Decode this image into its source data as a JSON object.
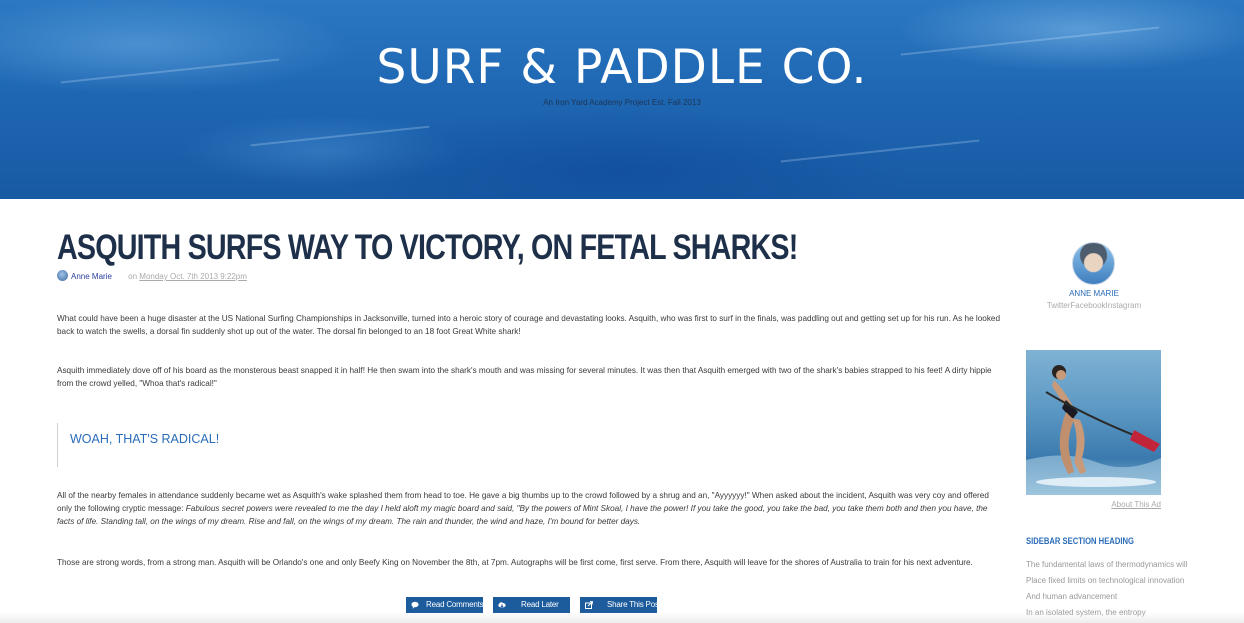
{
  "header": {
    "site_title": "SURF & PADDLE CO.",
    "tagline": "An Iron Yard Academy Project Est. Fall 2013"
  },
  "post": {
    "title": "ASQUITH SURFS WAY TO VICTORY, ON FETAL SHARKS!",
    "author": "Anne Marie",
    "on_label": "on",
    "date": "Monday Oct. 7th 2013 9:22pm",
    "paragraphs": [
      "What could have been a huge disaster at the US National Surfing Championships in Jacksonville, turned into a heroic story of courage and devastating looks. Asquith, who was first to surf in the finals, was paddling out and getting set up for his run. As he looked back to watch the swells, a dorsal fin suddenly shot up out of the water. The dorsal fin belonged to an 18 foot Great White shark!",
      "Asquith immediately dove off of his board as the monsterous beast snapped it in half! He then swam into the shark's mouth and was missing for several minutes. It was then that Asquith emerged with two of the shark's babies strapped to his feet! A dirty hippie from the crowd yelled, \"Whoa that's radical!\""
    ],
    "blockquote": "WOAH, THAT'S RADICAL!",
    "paragraph_3_start": "All of the nearby females in attendance suddenly became wet as Asquith's wake splashed them from head to toe. He gave a big thumbs up to the crowd followed by a shrug and an, \"Ayyyyyy!\" When asked about the incident, Asquith was very coy and offered only the following cryptic message: ",
    "paragraph_3_quote": "Fabulous secret powers were revealed to me the day I held aloft my magic board and said, \"By the powers of Mint Skoal, I have the power! If you take the good, you take the bad, you take them both and then you have, the facts of life. Standing tall, on the wings of my dream. Rise and fall, on the wings of my dream. The rain and thunder, the wind and haze, I'm bound for better days.",
    "paragraph_4": "Those are strong words, from a strong man. Asquith will be Orlando's one and only Beefy King on November the 8th, at 7pm. Autographs will be first come, first serve. From there, Asquith will leave for the shores of Australia to train for his next adventure.",
    "actions": {
      "comments": "Read Comments",
      "later": "Read Later",
      "share": "Share This Post"
    }
  },
  "sidebar": {
    "profile_name": "ANNE MARIE",
    "social_links": "TwitterFacebookInstagram",
    "about_ad": "About This Ad",
    "section_heading": "SIDEBAR SECTION HEADING",
    "lines": [
      "The fundamental laws of thermodynamics will",
      "Place fixed limits on technological innovation",
      "And human advancement",
      "In an isolated system, the entropy"
    ]
  },
  "colors": {
    "accent": "#2a6cb8",
    "button": "#1d5c9c",
    "title": "#1d2f49",
    "hero": "#1f67b3"
  },
  "icons": {
    "comments": "speech-bubble-icon",
    "later": "cloud-download-icon",
    "share": "share-box-icon"
  }
}
